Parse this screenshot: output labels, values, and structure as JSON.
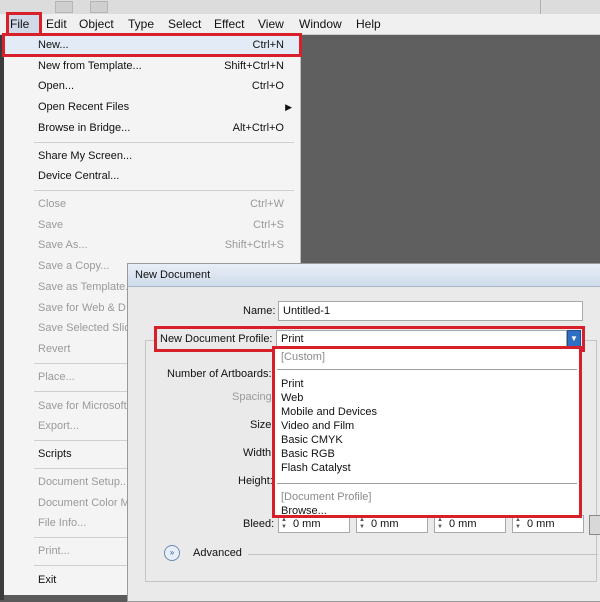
{
  "menubar": {
    "items": [
      "File",
      "Edit",
      "Object",
      "Type",
      "Select",
      "Effect",
      "View",
      "Window",
      "Help"
    ]
  },
  "file_menu": {
    "items": [
      {
        "label": "New...",
        "shortcut": "Ctrl+N"
      },
      {
        "label": "New from Template...",
        "shortcut": "Shift+Ctrl+N"
      },
      {
        "label": "Open...",
        "shortcut": "Ctrl+O"
      },
      {
        "label": "Open Recent Files",
        "shortcut": ""
      },
      {
        "label": "Browse in Bridge...",
        "shortcut": "Alt+Ctrl+O"
      },
      {
        "label": "Share My Screen...",
        "shortcut": ""
      },
      {
        "label": "Device Central...",
        "shortcut": ""
      },
      {
        "label": "Close",
        "shortcut": "Ctrl+W"
      },
      {
        "label": "Save",
        "shortcut": "Ctrl+S"
      },
      {
        "label": "Save As...",
        "shortcut": "Shift+Ctrl+S"
      },
      {
        "label": "Save a Copy...",
        "shortcut": ""
      },
      {
        "label": "Save as Template...",
        "shortcut": ""
      },
      {
        "label": "Save for Web & D",
        "shortcut": ""
      },
      {
        "label": "Save Selected Slic",
        "shortcut": ""
      },
      {
        "label": "Revert",
        "shortcut": ""
      },
      {
        "label": "Place...",
        "shortcut": ""
      },
      {
        "label": "Save for Microsoft",
        "shortcut": ""
      },
      {
        "label": "Export...",
        "shortcut": ""
      },
      {
        "label": "Scripts",
        "shortcut": ""
      },
      {
        "label": "Document Setup...",
        "shortcut": ""
      },
      {
        "label": "Document Color M",
        "shortcut": ""
      },
      {
        "label": "File Info...",
        "shortcut": ""
      },
      {
        "label": "Print...",
        "shortcut": ""
      },
      {
        "label": "Exit",
        "shortcut": ""
      }
    ]
  },
  "dialog": {
    "title": "New Document",
    "name_label": "Name:",
    "name_value": "Untitled-1",
    "profile_label": "New Document Profile:",
    "profile_value": "Print",
    "artboards_label": "Number of Artboards:",
    "spacing_label": "Spacing:",
    "size_label": "Size:",
    "width_label": "Width:",
    "height_label": "Height:",
    "bleed_label": "Bleed:",
    "bleed_values": [
      "0 mm",
      "0 mm",
      "0 mm",
      "0 mm"
    ],
    "advanced_label": "Advanced"
  },
  "profile_options": {
    "custom": "[Custom]",
    "items": [
      "Print",
      "Web",
      "Mobile and Devices",
      "Video and Film",
      "Basic CMYK",
      "Basic RGB",
      "Flash Catalyst"
    ],
    "document_profile": "[Document Profile]",
    "browse": "Browse..."
  },
  "colors": {
    "highlight": "#d8202a",
    "workspace": "#5f5f5f",
    "menu_bg": "#f4f4f4"
  }
}
